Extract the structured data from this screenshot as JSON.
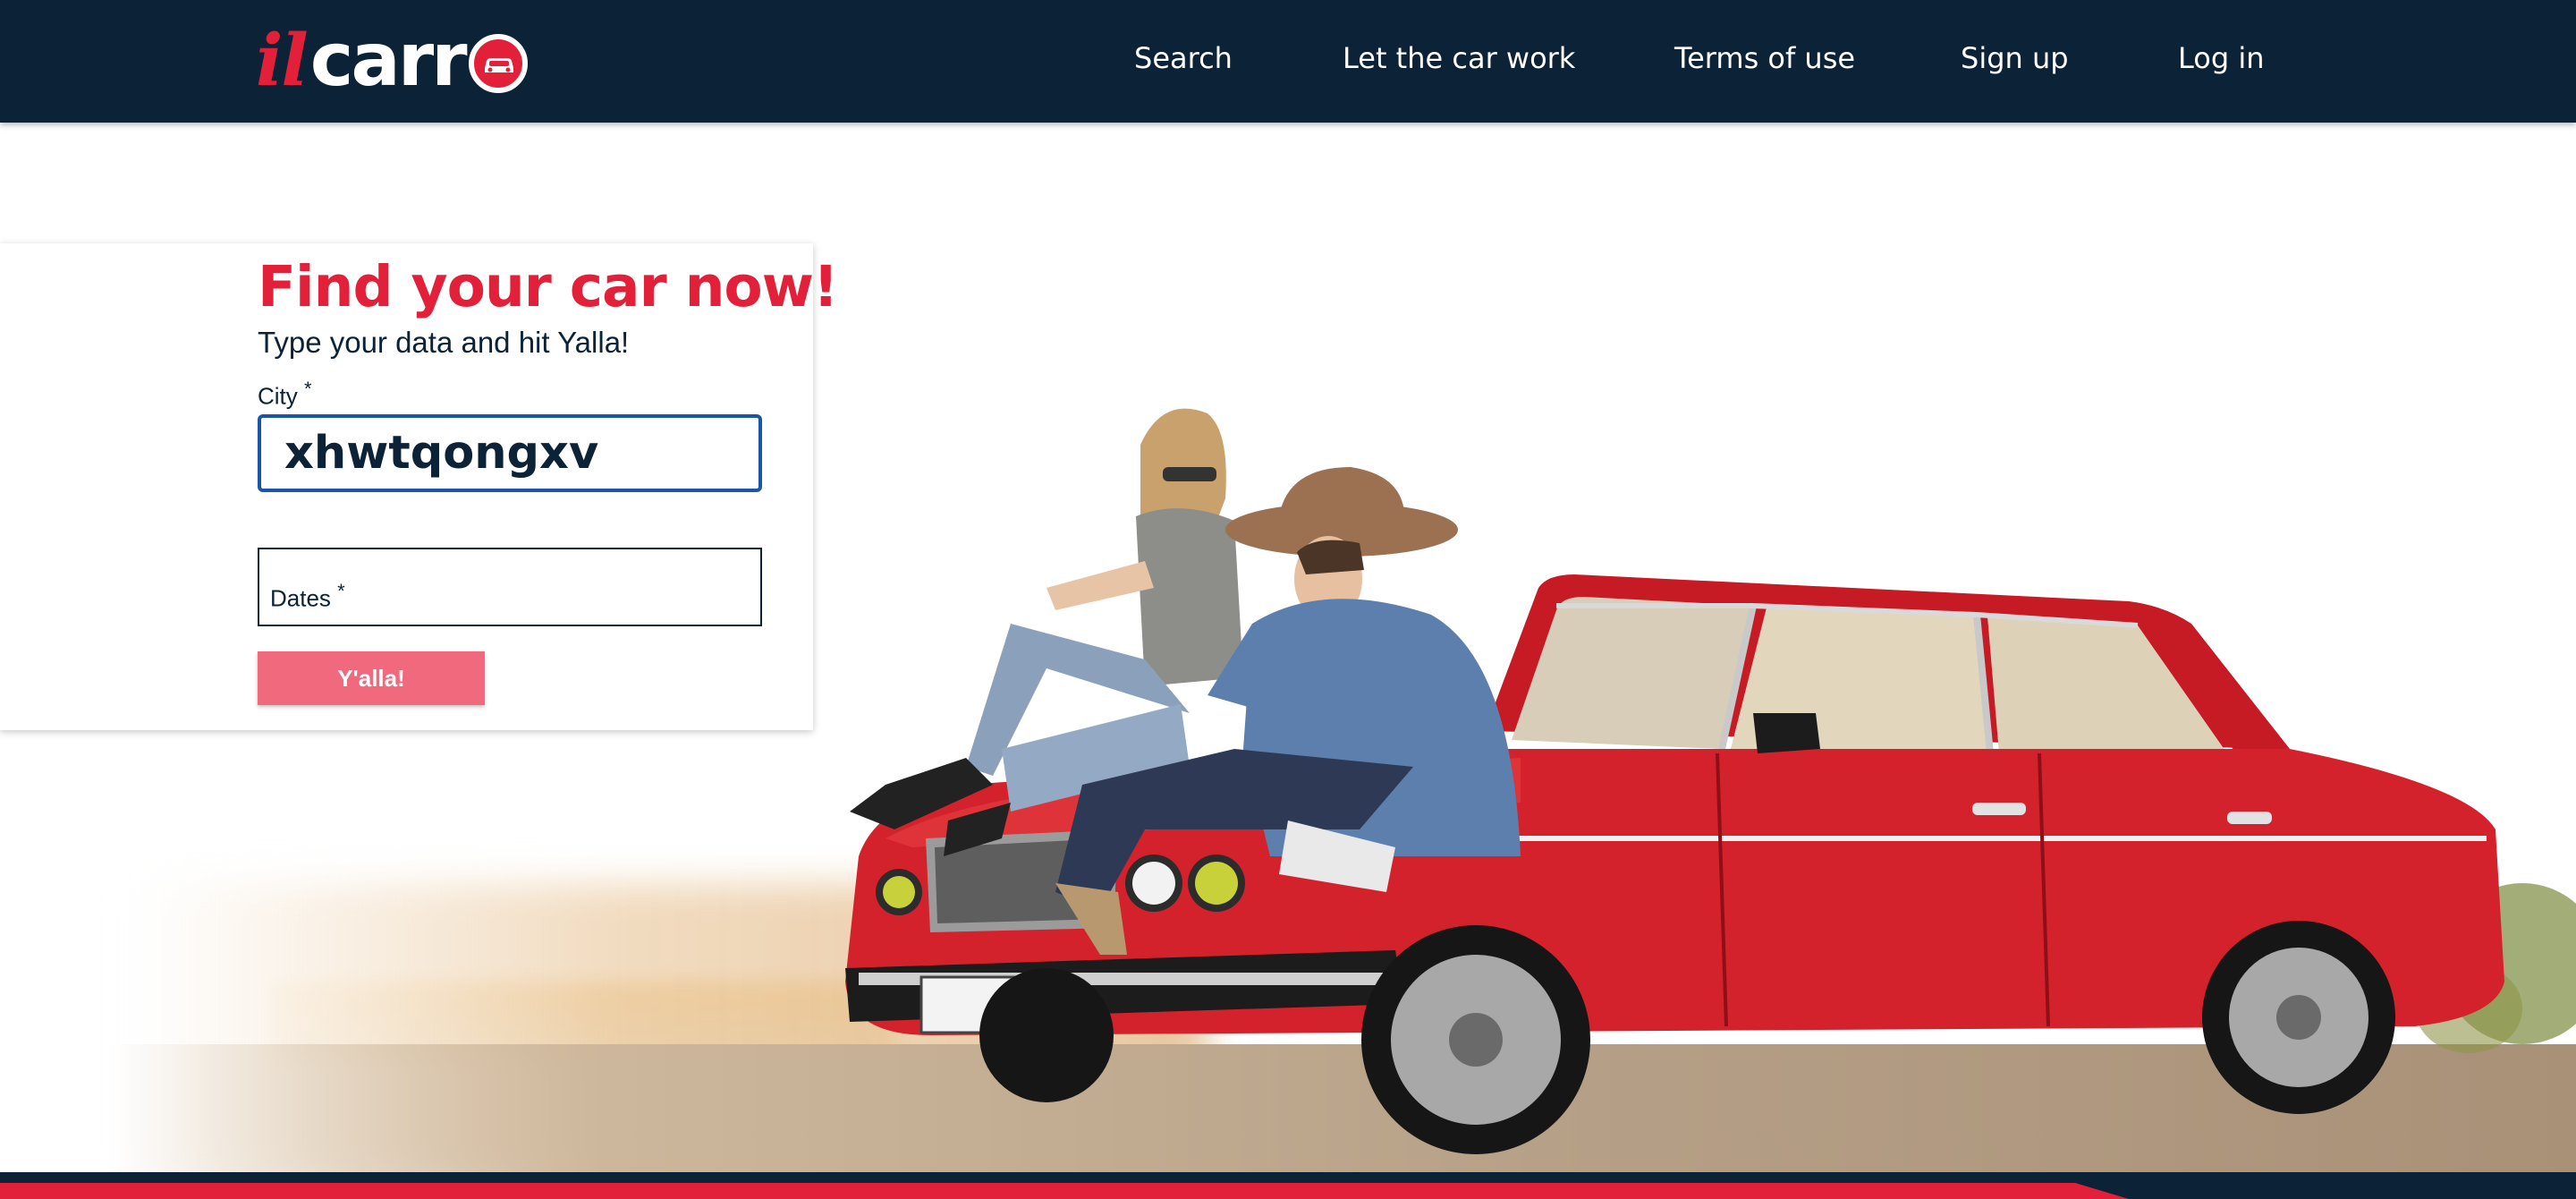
{
  "brand": {
    "logo_il": "il",
    "logo_carr": "carr",
    "colors": {
      "navy": "#0b2237",
      "red": "#e3203a",
      "button": "#f1697c",
      "focus_border": "#1a56a8"
    }
  },
  "nav": {
    "items": [
      {
        "label": "Search"
      },
      {
        "label": "Let the car work"
      },
      {
        "label": "Terms of use"
      },
      {
        "label": "Sign up"
      },
      {
        "label": "Log in"
      }
    ]
  },
  "search_form": {
    "title": "Find your car now!",
    "subtitle": "Type your data and hit Yalla!",
    "city_label": "City",
    "city_required_marker": "*",
    "city_value": "xhwtqongxv",
    "dates_label": "Dates",
    "dates_required_marker": "*",
    "dates_value": "",
    "submit_label": "Y'alla!"
  },
  "hero": {
    "image_icon": "couple-on-red-car-photo"
  }
}
